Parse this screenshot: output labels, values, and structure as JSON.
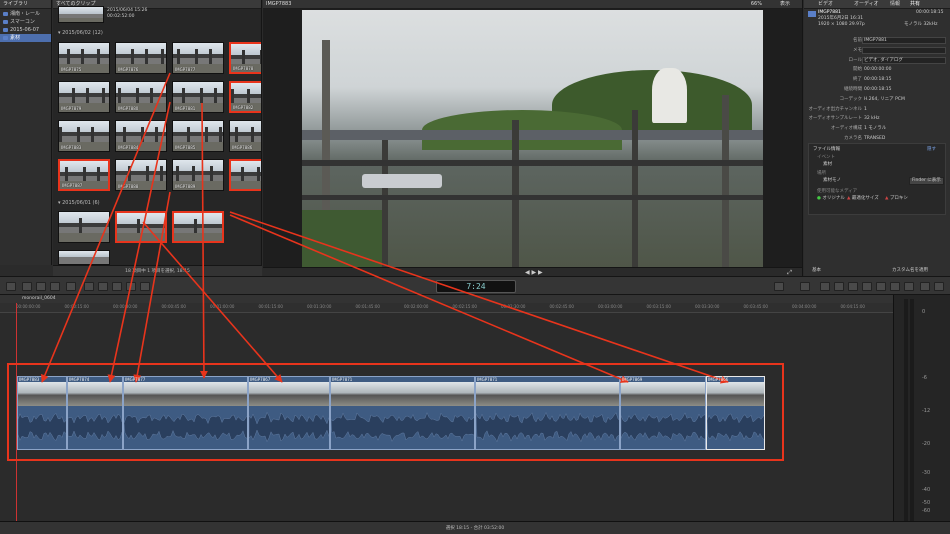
{
  "library": {
    "header": "ライブラリ",
    "items": [
      "湘南・レール",
      "スマーコン",
      "2015-06-07",
      "素材"
    ]
  },
  "browser": {
    "header": "すべてのクリップ",
    "top_clip": {
      "date": "2015/06/04 15:26",
      "duration": "00:02:52:00"
    },
    "events": [
      {
        "date": "2015/06/02",
        "count": "(12)"
      },
      {
        "date": "2015/06/01",
        "count": "(6)"
      }
    ],
    "thumb_labels": [
      "IMGP7875",
      "IMGP7876",
      "IMGP7877",
      "IMGP7878",
      "IMGP7879",
      "IMGP7880",
      "IMGP7881",
      "IMGP7882",
      "IMGP7883",
      "IMGP7884",
      "IMGP7885",
      "IMGP7886",
      "IMGP7887",
      "IMGP7888",
      "IMGP7889"
    ],
    "status": "18 項目中 1 項目を選択, 18:15"
  },
  "viewer": {
    "title": "IMGP7883",
    "zoom": "66%",
    "view": "表示"
  },
  "inspector": {
    "tabs": [
      "ビデオ",
      "オーディオ",
      "情報",
      "共有"
    ],
    "clip_name": "IMGP7881",
    "clip_date": "2015年6月2日 16:31",
    "clip_dur": "00:00:18:15",
    "clip_fmt": "1920 × 1080",
    "clip_fps": "29.97p",
    "clip_audio": "モノラル",
    "clip_rate": "32kHz",
    "rows": [
      {
        "k": "名前",
        "v": "IMGP7881"
      },
      {
        "k": "メモ",
        "v": ""
      },
      {
        "k": "ロール",
        "v": "ビデオ, ダイアログ"
      },
      {
        "k": "開始",
        "v": "00:00:00:00"
      },
      {
        "k": "終了",
        "v": "00:00:18:15"
      },
      {
        "k": "継続時間",
        "v": "00:00:18:15"
      },
      {
        "k": "コーデック",
        "v": "H.264, リニア PCM"
      },
      {
        "k": "オーディオ出力チャンネル",
        "v": "1"
      },
      {
        "k": "オーディオサンプルレート",
        "v": "32 kHz"
      },
      {
        "k": "オーディオ構成",
        "v": "1 モノラル"
      },
      {
        "k": "カメラ名",
        "v": "TRANSED"
      }
    ],
    "file_info": {
      "title": "ファイル情報",
      "hide": "隠す",
      "event_label": "イベント",
      "event": "素材",
      "location_label": "場所",
      "location": "素材モノ",
      "finder": "Finder に表示",
      "media_label": "使用可能なメディア",
      "media": [
        "オリジナル",
        "最適化サイズ",
        "プロキシ"
      ]
    },
    "bottom": {
      "left": "基本",
      "right": "カスタム名を適用"
    }
  },
  "toolbar": {
    "timecode": "7:24"
  },
  "timeline": {
    "project": "monorail_0604",
    "ticks": [
      "00:00:00:00",
      "00:00:15:00",
      "00:00:30:00",
      "00:00:45:00",
      "00:01:00:00",
      "00:01:15:00",
      "00:01:30:00",
      "00:01:45:00",
      "00:02:00:00",
      "00:02:15:00",
      "00:02:30:00",
      "00:02:45:00",
      "00:03:00:00",
      "00:03:15:00",
      "00:03:30:00",
      "00:03:45:00",
      "00:04:00:00",
      "00:04:15:00"
    ],
    "clips": [
      "IMGP7883",
      "IMGP7874",
      "IMGP7877",
      "IMGP7867",
      "IMGP7871",
      "IMGP7871",
      "IMGP7869",
      "IMGP7866"
    ],
    "status": "選択 18:15 - 合計 03:52:00"
  },
  "meter": {
    "labels": [
      "0",
      "-6",
      "-12",
      "-20",
      "-30",
      "-40",
      "-50",
      "-60"
    ]
  },
  "colors": {
    "highlight": "#e8341c",
    "selection": "#4d6fae"
  }
}
